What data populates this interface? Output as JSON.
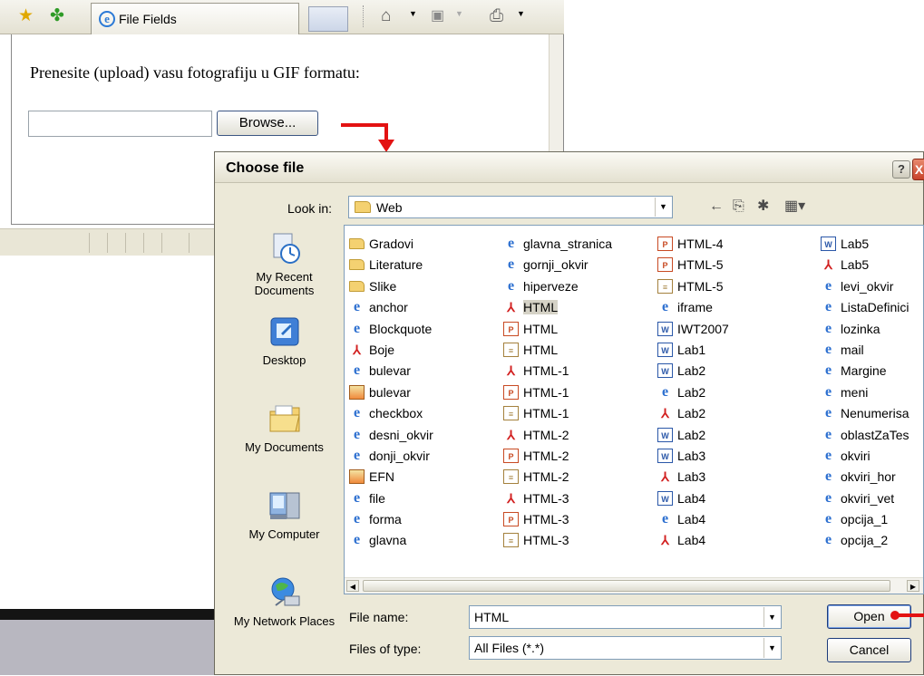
{
  "browser": {
    "tab_title": "File Fields",
    "upload_heading": "Prenesite (upload) vasu fotografiju u GIF formatu:",
    "browse_label": "Browse...",
    "upload_value": ""
  },
  "dialog": {
    "title": "Choose file",
    "help_label": "?",
    "close_label": "X",
    "look_in_label": "Look in:",
    "look_in_value": "Web",
    "places": [
      {
        "label": "My Recent Documents",
        "icon": "recent-documents-icon"
      },
      {
        "label": "Desktop",
        "icon": "desktop-icon"
      },
      {
        "label": "My Documents",
        "icon": "my-documents-icon"
      },
      {
        "label": "My Computer",
        "icon": "my-computer-icon"
      },
      {
        "label": "My Network Places",
        "icon": "network-places-icon"
      }
    ],
    "files": [
      [
        {
          "name": "Gradovi",
          "type": "folder"
        },
        {
          "name": "Literature",
          "type": "folder"
        },
        {
          "name": "Slike",
          "type": "folder"
        },
        {
          "name": "anchor",
          "type": "ie"
        },
        {
          "name": "Blockquote",
          "type": "ie"
        },
        {
          "name": "Boje",
          "type": "pdf"
        },
        {
          "name": "bulevar",
          "type": "ie"
        },
        {
          "name": "bulevar",
          "type": "img"
        },
        {
          "name": "checkbox",
          "type": "ie"
        },
        {
          "name": "desni_okvir",
          "type": "ie"
        },
        {
          "name": "donji_okvir",
          "type": "ie"
        },
        {
          "name": "EFN",
          "type": "img"
        },
        {
          "name": "file",
          "type": "ie"
        },
        {
          "name": "forma",
          "type": "ie"
        },
        {
          "name": "glavna",
          "type": "ie"
        }
      ],
      [
        {
          "name": "glavna_stranica",
          "type": "ie"
        },
        {
          "name": "gornji_okvir",
          "type": "ie"
        },
        {
          "name": "hiperveze",
          "type": "ie"
        },
        {
          "name": "HTML",
          "type": "pdf",
          "selected": true
        },
        {
          "name": "HTML",
          "type": "ppt"
        },
        {
          "name": "HTML",
          "type": "txt"
        },
        {
          "name": "HTML-1",
          "type": "pdf"
        },
        {
          "name": "HTML-1",
          "type": "ppt"
        },
        {
          "name": "HTML-1",
          "type": "txt"
        },
        {
          "name": "HTML-2",
          "type": "pdf"
        },
        {
          "name": "HTML-2",
          "type": "ppt"
        },
        {
          "name": "HTML-2",
          "type": "txt"
        },
        {
          "name": "HTML-3",
          "type": "pdf"
        },
        {
          "name": "HTML-3",
          "type": "ppt"
        },
        {
          "name": "HTML-3",
          "type": "txt"
        }
      ],
      [
        {
          "name": "HTML-4",
          "type": "ppt"
        },
        {
          "name": "HTML-5",
          "type": "ppt"
        },
        {
          "name": "HTML-5",
          "type": "txt"
        },
        {
          "name": "iframe",
          "type": "ie"
        },
        {
          "name": "IWT2007",
          "type": "word"
        },
        {
          "name": "Lab1",
          "type": "word"
        },
        {
          "name": "Lab2",
          "type": "word"
        },
        {
          "name": "Lab2",
          "type": "ie"
        },
        {
          "name": "Lab2",
          "type": "pdf"
        },
        {
          "name": "Lab2",
          "type": "word"
        },
        {
          "name": "Lab3",
          "type": "word"
        },
        {
          "name": "Lab3",
          "type": "pdf"
        },
        {
          "name": "Lab4",
          "type": "word"
        },
        {
          "name": "Lab4",
          "type": "ie"
        },
        {
          "name": "Lab4",
          "type": "pdf"
        }
      ],
      [
        {
          "name": "Lab5",
          "type": "word"
        },
        {
          "name": "Lab5",
          "type": "pdf"
        },
        {
          "name": "levi_okvir",
          "type": "ie"
        },
        {
          "name": "ListaDefinici",
          "type": "ie"
        },
        {
          "name": "lozinka",
          "type": "ie"
        },
        {
          "name": "mail",
          "type": "ie"
        },
        {
          "name": "Margine",
          "type": "ie"
        },
        {
          "name": "meni",
          "type": "ie"
        },
        {
          "name": "Nenumerisa",
          "type": "ie"
        },
        {
          "name": "oblastZaTes",
          "type": "ie"
        },
        {
          "name": "okviri",
          "type": "ie"
        },
        {
          "name": "okviri_hor",
          "type": "ie"
        },
        {
          "name": "okviri_vet",
          "type": "ie"
        },
        {
          "name": "opcija_1",
          "type": "ie"
        },
        {
          "name": "opcija_2",
          "type": "ie"
        }
      ]
    ],
    "file_name_label": "File name:",
    "file_name_value": "HTML",
    "file_type_label": "Files of type:",
    "file_type_value": "All Files (*.*)",
    "open_label": "Open",
    "cancel_label": "Cancel"
  },
  "colors": {
    "annotation_arrow": "#e31212",
    "selection": "#d5d2c6"
  }
}
